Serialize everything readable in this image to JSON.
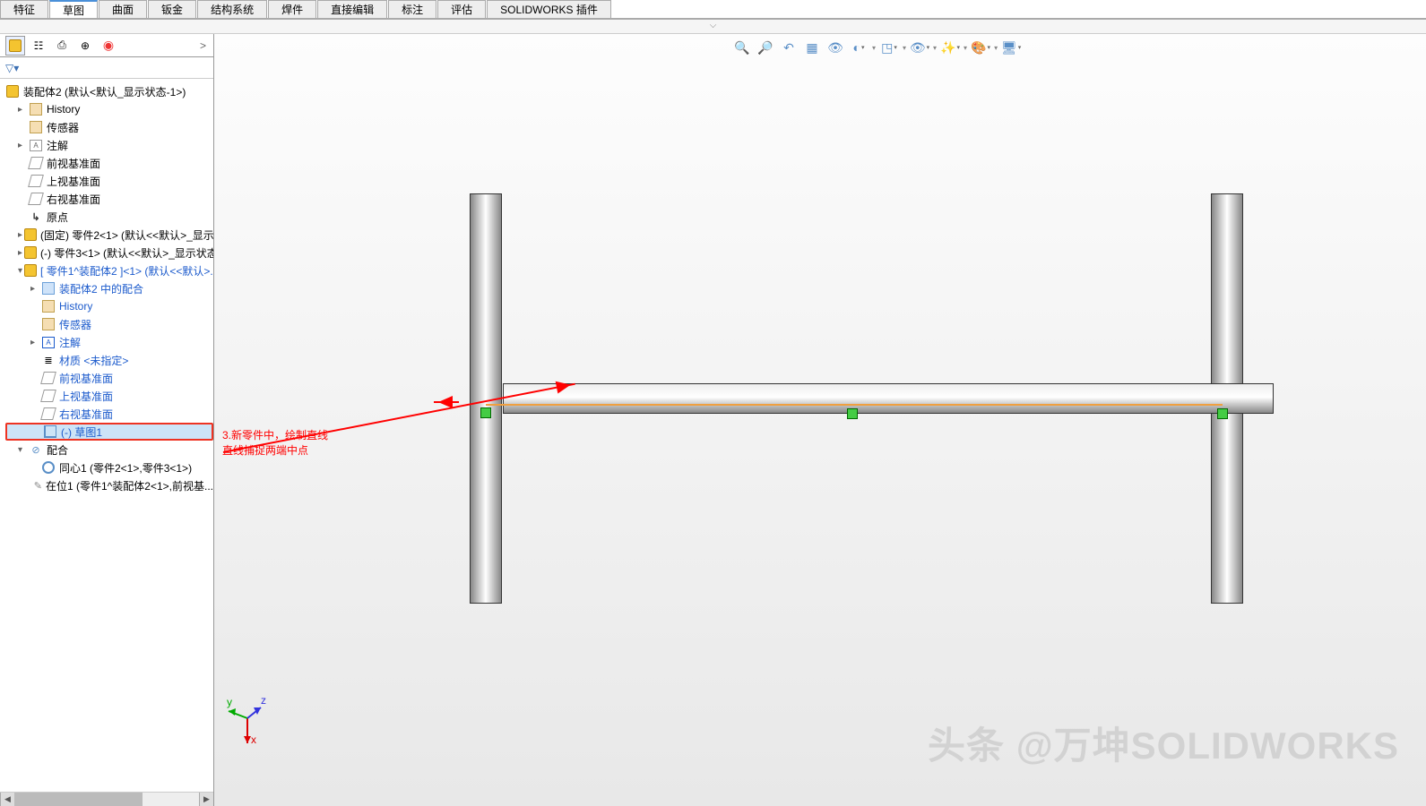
{
  "ribbon": {
    "tabs": [
      "特征",
      "草图",
      "曲面",
      "钣金",
      "结构系统",
      "焊件",
      "直接编辑",
      "标注",
      "评估",
      "SOLIDWORKS 插件"
    ],
    "active_index": 1
  },
  "panel": {
    "filter_arrow": "▾",
    "nav_arrow": ">"
  },
  "tree": {
    "root": "装配体2  (默认<默认_显示状态-1>)",
    "history": "History",
    "sensors": "传感器",
    "annot": "注解",
    "front": "前视基准面",
    "top": "上视基准面",
    "right": "右视基准面",
    "origin": "原点",
    "fixed_part2": "(固定) 零件2<1>  (默认<<默认>_显示...",
    "part3": "(-) 零件3<1>  (默认<<默认>_显示状态...",
    "part1_asm": "[ 零件1^装配体2 ]<1>  (默认<<默认>...",
    "sub_mates": "装配体2 中的配合",
    "sub_history": "History",
    "sub_sensors": "传感器",
    "sub_annot": "注解",
    "material": "材质 <未指定>",
    "sub_front": "前视基准面",
    "sub_top": "上视基准面",
    "sub_right": "右视基准面",
    "sketch1": "(-) 草图1",
    "mates": "配合",
    "concentric": "同心1 (零件2<1>,零件3<1>)",
    "coincident": "在位1 (零件1^装配体2<1>,前视基..."
  },
  "annotation": {
    "line1": "3.新零件中，绘制直线",
    "line2": "直线捕捉两端中点"
  },
  "watermark": "头条 @万坤SOLIDWORKS",
  "view_icons": [
    "zoom-fit",
    "zoom-area",
    "prev-view",
    "section",
    "view-orient",
    "display-style",
    "",
    "cube-view",
    "",
    "eye-visibility",
    "",
    "render",
    "",
    "color-appear",
    "",
    "monitor"
  ]
}
